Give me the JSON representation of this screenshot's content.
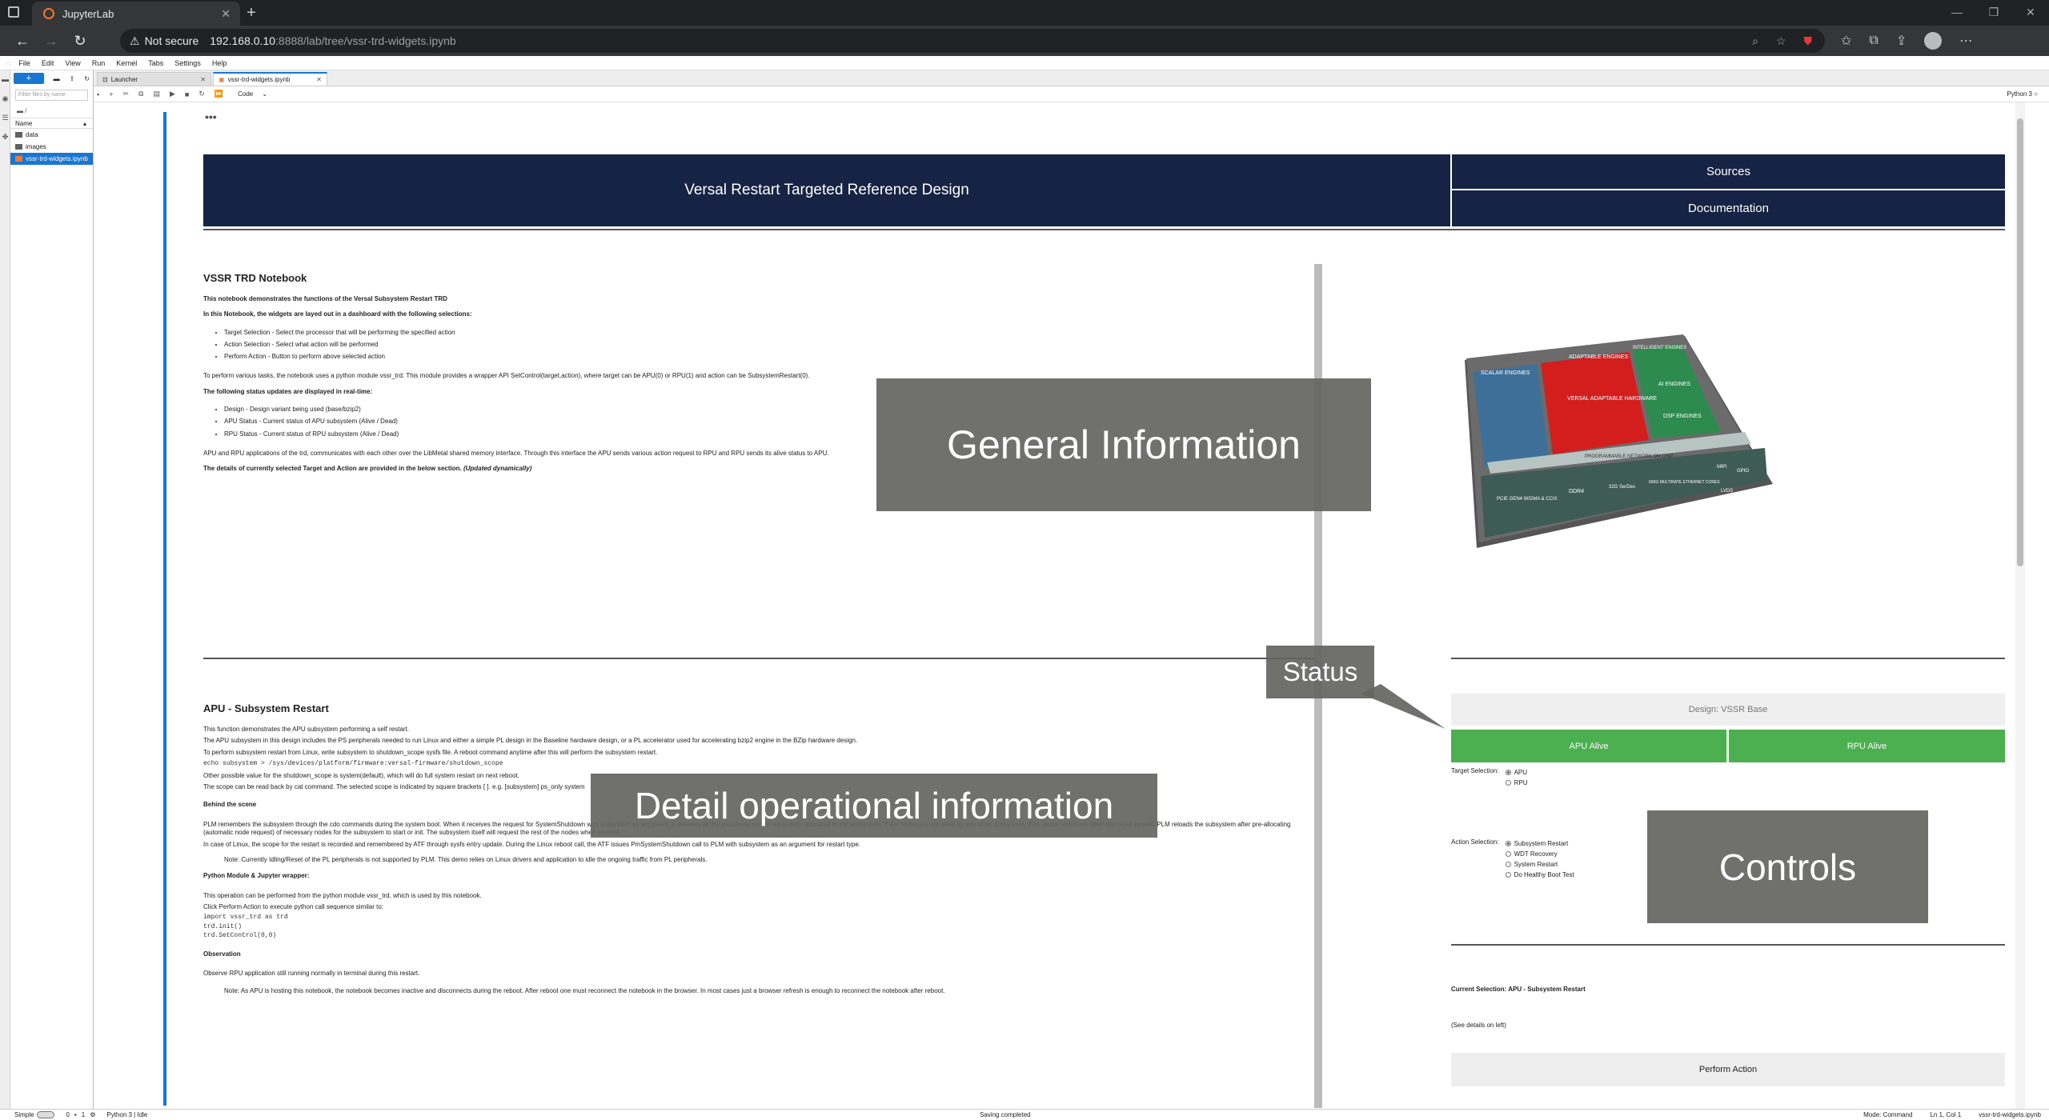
{
  "browser": {
    "tab_title": "JupyterLab",
    "security": "Not secure",
    "url_host": "192.168.0.10",
    "url_path": ":8888/lab/tree/vssr-trd-widgets.ipynb"
  },
  "menu": [
    "File",
    "Edit",
    "View",
    "Run",
    "Kernel",
    "Tabs",
    "Settings",
    "Help"
  ],
  "filebrowser": {
    "filter_placeholder": "Filter files by name",
    "crumb": "/",
    "col_name": "Name",
    "items": [
      "data",
      "images",
      "vssr-trd-widgets.ipynb"
    ]
  },
  "tabs": [
    "Launcher",
    "vssr-trd-widgets.ipynb"
  ],
  "toolbar": {
    "cell_type": "Code",
    "kernel": "Python 3"
  },
  "header": {
    "title": "Versal Restart Targeted Reference Design",
    "sources": "Sources",
    "documentation": "Documentation"
  },
  "notebook_info": {
    "heading": "VSSR TRD Notebook",
    "p1": "This notebook demonstrates the functions of the Versal Subsystem Restart TRD",
    "p2": "In this Notebook, the widgets are layed out in a dashboard with the following selections:",
    "list1": [
      "Target Selection - Select the processor that will be performing the specified action",
      "Action Selection - Select what action will be performed",
      "Perform Action - Button to perform above selected action"
    ],
    "p3": "To perform various tasks, the notebook uses a python module vssr_trd. This module provides a wrapper API SetControl(target,action), where target can be APU(0) or RPU(1) and action can be SubsystemRestart(0).",
    "p4": "The following status updates are displayed in real-time:",
    "list2": [
      "Design - Design variant being used (base/bzip2)",
      "APU Status - Current status of APU subsystem (Alive / Dead)",
      "RPU Status - Current status of RPU subsystem (Alive / Dead)"
    ],
    "p5": "APU and RPU applications of the trd, communicates with each other over the LibMetal shared memory interface. Through this interface the APU sends various action request to RPU and RPU sends its alive status to APU.",
    "p6": "The details of currently selected Target and Action are provided in the below section.",
    "p6_em": "(Updated dynamically)"
  },
  "detail": {
    "heading": "APU - Subsystem Restart",
    "lines": [
      "This function demonstrates the APU subsystem performing a self restart.",
      "The APU subsystem in this design includes the PS peripherals needed to run Linux and either a simple PL design in the Baseline hardware design, or a PL accelerator used for accelerating bzip2 engine in the BZip hardware design.",
      "To perform subsystem restart from Linux, write subsystem to shutdown_scope sysfs file. A reboot command anytime after this will perform the subsystem restart."
    ],
    "code1": "echo subsystem > /sys/devices/platform/firmware:versal-firmware/shutdown_scope",
    "lines2": [
      "Other possible value for the shutdown_scope is system(default), which will do full system restart on next reboot.",
      "The scope can be read back by cat command. The selected scope is indicated by square brackets [ ]. e.g. [subsystem] ps_only system"
    ],
    "h_behind": "Behind the scene",
    "behind": [
      "PLM remembers the subsystem through the cdo commands during the system boot. When it receives the request for SystemShutdown with subsystem as argument, it releases all the peripheral nodes requested / allocated to the subsystem. If the nodes are not used by any other subsystem, then those nodes are idled and reset as well. PLM reloads the subsystem after pre-allocating (automatic node request) of necessary nodes for the subsystem to start or init. The subsystem itself will request the rest of the nodes when needed.",
      "In case of Linux, the scope for the restart is recorded and remembered by ATF through sysfs entry update. During the Linux reboot call, the ATF issues PmSystemShutdown call to PLM with subsystem as an argument for restart type."
    ],
    "note1": "Note: Currently Idling/Reset of the PL peripherals is not supported by PLM. This demo relies on Linux drivers and application to idle the ongoing traffic from PL peripherals.",
    "h_python": "Python Module & Jupyter wrapper:",
    "python": [
      "This operation can be performed from the python module vssr_trd, which is used by this notebook.",
      "Click Perform Action to execute python call sequence similar to:"
    ],
    "code2": [
      "import vssr_trd as trd",
      "trd.init()",
      "trd.SetControl(0,0)"
    ],
    "h_obs": "Observation",
    "obs": "Observe RPU application still running normally in terminal during this restart.",
    "note2": "Note: As APU is hosting this notebook, the notebook becomes inactive and disconnects during the reboot. After reboot one must reconnect the notebook in the browser. In most cases just a browser refresh is enough to reconnect the notebook after reboot."
  },
  "chip": {
    "scalar": "SCALAR ENGINES",
    "adaptable": "ADAPTABLE ENGINES",
    "intelligent": "INTELLIGENT ENGINES",
    "versal": "VERSAL ADAPTABLE HARDWARE",
    "ai": "AI ENGINES",
    "dsp": "DSP ENGINES",
    "noc": "PROGRAMMABLE NETWORK ON CHIP",
    "pcie": "PCIE GEN4 W/DMA & CCIX",
    "ddr4": "DDR4",
    "serdes": "32G SerDes",
    "eth": "600G MULTIRATE ETHERNET CORES",
    "mipi": "MIPI",
    "lvds": "LVDS",
    "gpio": "GPIO"
  },
  "overlays": {
    "general": "General Information",
    "detail": "Detail operational information",
    "status": "Status",
    "controls": "Controls"
  },
  "panel": {
    "design": "Design: VSSR Base",
    "apu": "APU Alive",
    "rpu": "RPU Alive",
    "target_label": "Target Selection:",
    "targets": [
      "APU",
      "RPU"
    ],
    "action_label": "Action Selection:",
    "actions": [
      "Subsystem Restart",
      "WDT Recovery",
      "System Restart",
      "Do Healthy Boot Test"
    ],
    "current": "Current Selection: APU - Subsystem Restart",
    "see": "(See details on left)",
    "perform": "Perform Action"
  },
  "statusbar": {
    "mode": "Simple",
    "c1": "0",
    "c2": "1",
    "kernel": "Python 3 | Idle",
    "msg": "Saving completed",
    "cmd": "Mode: Command",
    "pos": "Ln 1, Col 1",
    "file": "vssr-trd-widgets.ipynb"
  },
  "colors": {
    "header_bg": "#172345",
    "alive": "#4caf50",
    "accent": "#1976d2"
  }
}
